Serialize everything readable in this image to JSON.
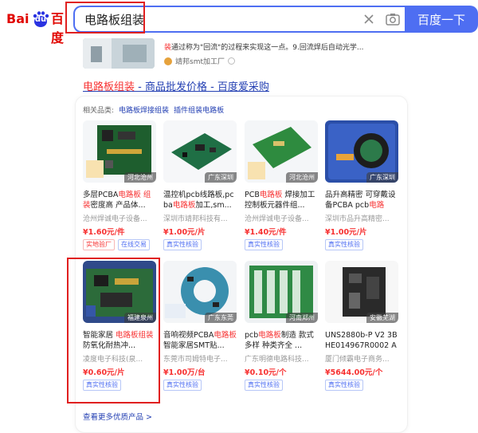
{
  "header": {
    "logo_bai": "Bai",
    "logo_du": "du",
    "logo_cn": "百度",
    "search_value": "电路板组装",
    "search_button": "百度一下"
  },
  "snippet": {
    "text_hl": "装",
    "text": "通过称为\"回流\"的过程来实现这一点。9.回流焊后自动光学...",
    "source": "靖邦smt加工厂"
  },
  "result": {
    "title_hl": "电路板组装",
    "title_rest": " - 商品批发价格 - 百度爱采购"
  },
  "related": {
    "label": "相关品类:",
    "links": [
      "电路板焊接组装",
      "插件组装电路板"
    ]
  },
  "products": [
    {
      "name_a": "多层PCBA",
      "name_hl": "电路板 组装",
      "name_b": "密度高 产品体...",
      "shop": "沧州焊诚电子设备...",
      "price": "¥1.60元/件",
      "tags": [
        "实地验厂",
        "在线交易"
      ],
      "location": "河北沧州"
    },
    {
      "name_a": "温控机pcb线路板,pcba",
      "name_hl": "电路板",
      "name_b": "加工,sm...",
      "shop": "深圳市靖邦科技有...",
      "price": "¥1.00元/片",
      "tags": [
        "真实性核验"
      ],
      "location": "广东深圳"
    },
    {
      "name_a": "PCB",
      "name_hl": "电路板",
      "name_b": " 焊接加工控制板元器件组...",
      "shop": "沧州焊诚电子设备...",
      "price": "¥1.40元/件",
      "tags": [
        "真实性核验"
      ],
      "location": "河北沧州"
    },
    {
      "name_a": "品升高精密 可穿戴设备PCBA pcb",
      "name_hl": "电路板",
      "name_b": "...",
      "shop": "深圳市品升高精密...",
      "price": "¥1.00元/片",
      "tags": [
        "真实性核验"
      ],
      "location": "广东深圳"
    },
    {
      "name_a": "智能家居 ",
      "name_hl": "电路板组装",
      "name_b": " 防氧化耐热冲...",
      "shop": "凌度电子科技(泉...",
      "price": "¥0.60元/片",
      "tags": [
        "真实性核验"
      ],
      "location": "福建泉州"
    },
    {
      "name_a": "音响视频PCBA",
      "name_hl": "电路板",
      "name_b": " 智能家居SMT贴...",
      "shop": "东莞市司姆特电子...",
      "price": "¥1.00万/台",
      "tags": [
        "真实性核验"
      ],
      "location": "广东东莞"
    },
    {
      "name_a": "pcb",
      "name_hl": "电路板",
      "name_b": "制造 款式多样 种类齐全 ...",
      "shop": "广东明德电路科技...",
      "price": "¥0.10元/个",
      "tags": [
        "真实性核验"
      ],
      "location": "河南郑州"
    },
    {
      "name_a": "UNS2880b-P V2 3BHE014967R0002 ABB...",
      "name_hl": "",
      "name_b": "",
      "shop": "厦门倾霸电子商务...",
      "price": "¥5644.00元/个",
      "tags": [
        "真实性核验"
      ],
      "location": "安徽芜湖"
    }
  ],
  "more": "查看更多优质产品 >",
  "colors": {
    "accent": "#4e6ef2",
    "highlight": "#f73131",
    "link": "#2440b3"
  }
}
